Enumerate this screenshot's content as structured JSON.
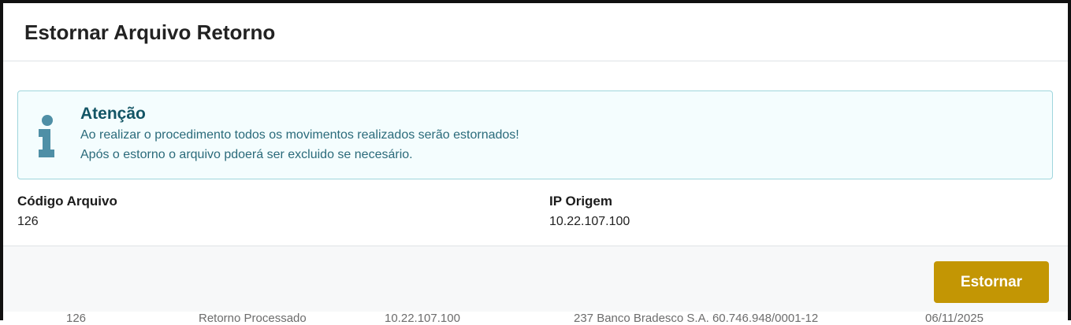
{
  "modal": {
    "title": "Estornar Arquivo Retorno"
  },
  "alert": {
    "icon": "info-icon",
    "title": "Atenção",
    "line1": "Ao realizar o procedimento todos os movimentos realizados serão estornados!",
    "line2": "Após o estorno o arquivo pdoerá ser excluido se necesário."
  },
  "fields": {
    "codigo": {
      "label": "Código Arquivo",
      "value": "126"
    },
    "ip": {
      "label": "IP Origem",
      "value": "10.22.107.100"
    }
  },
  "footer": {
    "estornar_label": "Estornar"
  },
  "background_row": {
    "col1": "126",
    "col2": "Retorno Processado",
    "col3": "10.22.107.100",
    "col4": "237 Banco Bradesco S.A. 60.746.948/0001-12",
    "col5": "06/11/2025"
  },
  "colors": {
    "accent_button": "#c39604",
    "alert_background": "#f4fdfe",
    "alert_border": "#9fd6dd",
    "alert_text": "#2a6a7a"
  }
}
